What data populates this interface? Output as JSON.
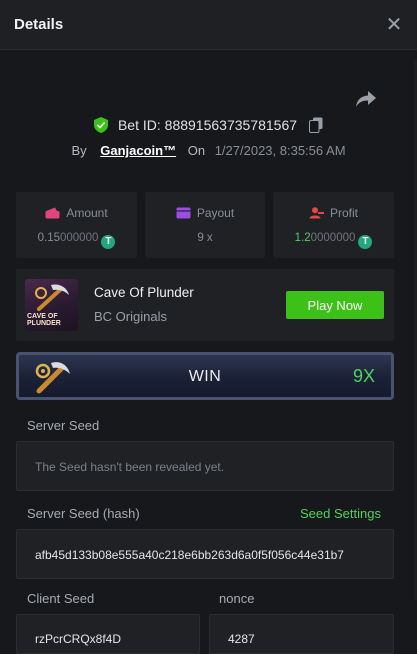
{
  "header": {
    "title": "Details",
    "close_icon": "close-icon"
  },
  "bet": {
    "id_label": "Bet ID: 88891563735781567",
    "by_label": "By",
    "user": "Ganjacoin™",
    "on_label": "On",
    "date": "1/27/2023, 8:35:56 AM"
  },
  "stats": {
    "amount": {
      "label": "Amount",
      "value_main": "0.15",
      "value_dim": "000000",
      "icon": "wallet-icon"
    },
    "payout": {
      "label": "Payout",
      "value": "9 x",
      "icon": "card-icon"
    },
    "profit": {
      "label": "Profit",
      "value_main": "1.2",
      "value_dim": "0000000",
      "icon": "user-coin-icon"
    },
    "coin_symbol": "T"
  },
  "game": {
    "name": "Cave Of Plunder",
    "provider": "BC Originals",
    "thumb_text_1": "CAVE OF",
    "thumb_text_2": "PLUNDER",
    "play_label": "Play Now"
  },
  "result": {
    "label": "WIN",
    "multiplier": "9X"
  },
  "seeds": {
    "server_label": "Server Seed",
    "server_value": "The Seed hasn't been revealed yet.",
    "server_hash_label": "Server Seed (hash)",
    "settings_label": "Seed Settings",
    "server_hash_value": "afb45d133b08e555a40c218e6bb263d6a0f5f056c44e31b7",
    "client_label": "Client Seed",
    "client_value": "rzPcrCRQx8f4D",
    "nonce_label": "nonce",
    "nonce_value": "4287"
  },
  "colors": {
    "accent_green": "#3bc117",
    "text_green": "#4fd15c",
    "background": "#17181b",
    "panel": "#1f2125",
    "amount_icon": "#e0457b",
    "payout_icon": "#9b4fe0",
    "profit_icon": "#e54848"
  }
}
